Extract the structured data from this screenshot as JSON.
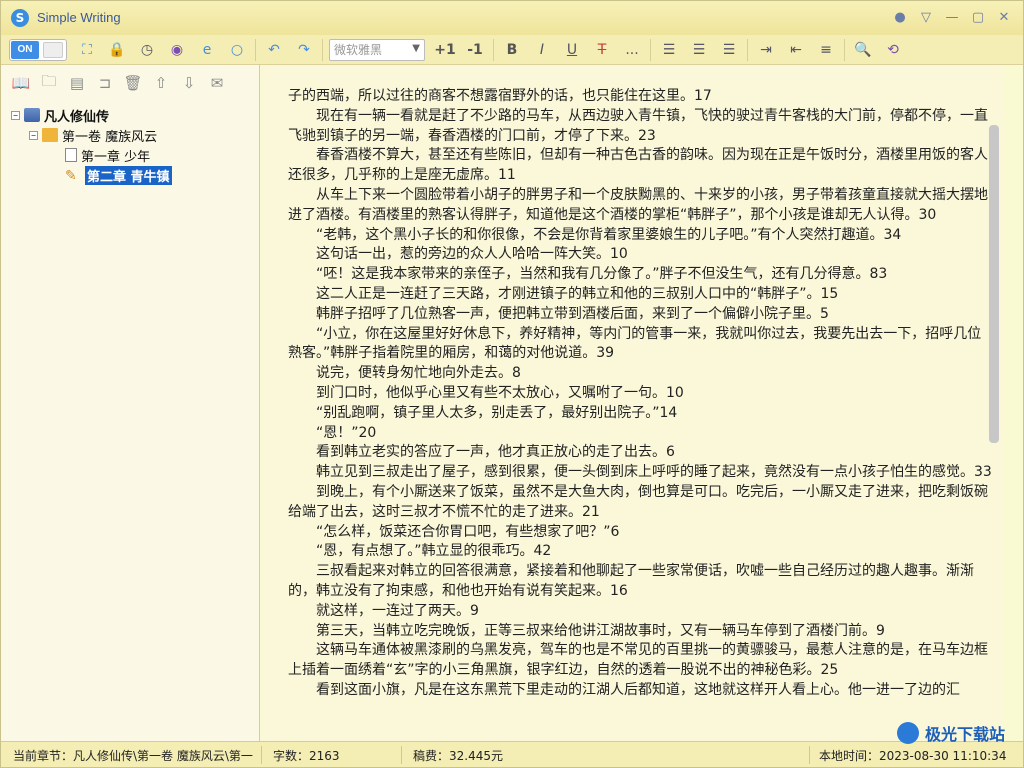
{
  "window": {
    "title": "Simple Writing"
  },
  "toolbar": {
    "toggle_label": "ON",
    "font_placeholder": "微软雅黑",
    "buttons": {
      "size_up": "+1",
      "size_down": "-1",
      "bold": "B",
      "italic": "I",
      "underline": "U",
      "strike": "T",
      "more": "..."
    }
  },
  "tree": {
    "root": "凡人修仙传",
    "volume": "第一卷 魔族风云",
    "chapters": [
      "第一章 少年",
      "第二章 青牛镇"
    ]
  },
  "editor": {
    "paragraphs": [
      {
        "text": "子的西端，所以过往的商客不想露宿野外的话，也只能住在这里。17",
        "first": true
      },
      {
        "text": "现在有一辆一看就是赶了不少路的马车，从西边驶入青牛镇，飞快的驶过青牛客栈的大门前，停都不停，一直飞驰到镇子的另一端，春香酒楼的门口前，才停了下来。23"
      },
      {
        "text": "春香酒楼不算大，甚至还有些陈旧，但却有一种古色古香的韵味。因为现在正是午饭时分，酒楼里用饭的客人还很多，几乎称的上是座无虚席。11"
      },
      {
        "text": "从车上下来一个圆脸带着小胡子的胖男子和一个皮肤黝黑的、十来岁的小孩，男子带着孩童直接就大摇大摆地进了酒楼。有酒楼里的熟客认得胖子，知道他是这个酒楼的掌柜“韩胖子”，那个小孩是谁却无人认得。30"
      },
      {
        "text": "“老韩，这个黑小子长的和你很像，不会是你背着家里婆娘生的儿子吧。”有个人突然打趣道。34"
      },
      {
        "text": "这句话一出，惹的旁边的众人人哈哈一阵大笑。10"
      },
      {
        "text": "“呸！这是我本家带来的亲侄子，当然和我有几分像了。”胖子不但没生气，还有几分得意。83"
      },
      {
        "text": "这二人正是一连赶了三天路，才刚进镇子的韩立和他的三叔别人口中的“韩胖子”。15"
      },
      {
        "text": "韩胖子招呼了几位熟客一声，便把韩立带到酒楼后面，来到了一个偏僻小院子里。5"
      },
      {
        "text": "“小立，你在这屋里好好休息下，养好精神，等内门的管事一来，我就叫你过去，我要先出去一下，招呼几位熟客。”韩胖子指着院里的厢房，和蔼的对他说道。39"
      },
      {
        "text": "说完，便转身匆忙地向外走去。8"
      },
      {
        "text": "到门口时，他似乎心里又有些不太放心，又嘱咐了一句。10"
      },
      {
        "text": "“别乱跑啊，镇子里人太多，别走丢了，最好别出院子。”14"
      },
      {
        "text": "“恩！”20"
      },
      {
        "text": "看到韩立老实的答应了一声，他才真正放心的走了出去。6"
      },
      {
        "text": "韩立见到三叔走出了屋子，感到很累，便一头倒到床上呼呼的睡了起来，竟然没有一点小孩子怕生的感觉。33"
      },
      {
        "text": "到晚上，有个小厮送来了饭菜，虽然不是大鱼大肉，倒也算是可口。吃完后，一小厮又走了进来，把吃剩饭碗给端了出去，这时三叔才不慌不忙的走了进来。21"
      },
      {
        "text": "“怎么样，饭菜还合你胃口吧，有些想家了吧？”6"
      },
      {
        "text": "“恩，有点想了。”韩立显的很乖巧。42"
      },
      {
        "text": "三叔看起来对韩立的回答很满意，紧接着和他聊起了一些家常便话，吹嘘一些自己经历过的趣人趣事。渐渐的，韩立没有了拘束感，和他也开始有说有笑起来。16"
      },
      {
        "text": "就这样，一连过了两天。9"
      },
      {
        "text": "第三天，当韩立吃完晚饭，正等三叔来给他讲江湖故事时，又有一辆马车停到了酒楼门前。9"
      },
      {
        "text": "这辆马车通体被黑漆刷的乌黑发亮，驾车的也是不常见的百里挑一的黄骠骏马，最惹人注意的是，在马车边框上插着一面绣着“玄”字的小三角黑旗，银字红边，自然的透着一股说不出的神秘色彩。25"
      },
      {
        "text": "看到这面小旗，凡是在这东黑荒下里走动的江湖人后都知道，这地就这样开人看上心。他一进一了边的汇"
      }
    ]
  },
  "status": {
    "current_chapter": "当前章节：凡人修仙传\\第一卷 魔族风云\\第一",
    "word_count": "字数：2163",
    "fee": "稿费：32.445元",
    "local_time": "本地时间：2023-08-30 11:10:34"
  },
  "watermark": {
    "text": "极光下载站"
  }
}
